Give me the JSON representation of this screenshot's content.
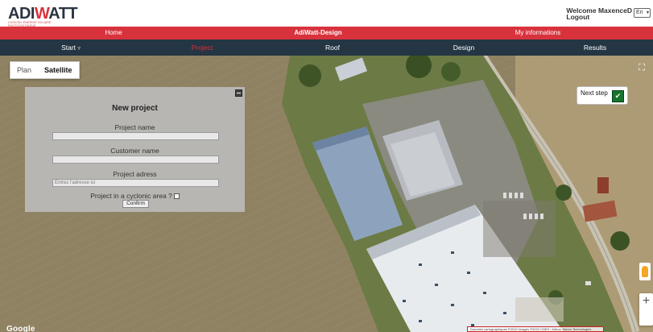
{
  "header": {
    "logo_text_a": "ADI",
    "logo_text_w": "W",
    "logo_text_b": "ATT",
    "logo_tagline": "LOGICIEL ÉNERGIE SOLAIRE PHOTOVOLTAÏQUE",
    "welcome_text": "Welcome  MaxenceD",
    "logout_label": "Logout",
    "language_value": "En"
  },
  "nav_top": {
    "items": [
      "Home",
      "AdiWatt-Design",
      "My informations"
    ]
  },
  "nav_main": {
    "start_label": "Start",
    "start_icon": "triangle-down",
    "items": [
      "Project",
      "Roof",
      "Design",
      "Results"
    ],
    "active": "Project",
    "active_color": "#d8323c"
  },
  "map": {
    "map_types": [
      "Plan",
      "Satellite"
    ],
    "selected_map_type": "Satellite",
    "next_step_label": "Next step",
    "next_step_icon": "checkmark-icon",
    "fullscreen_icon": "fullscreen-icon",
    "zoom_in_label": "+",
    "google_label": "Google",
    "attribution": "Données cartographiques ©2022 Images ©2022 CNES / Airbus, Maxar Technologies"
  },
  "panel": {
    "title": "New project",
    "project_name_label": "Project name",
    "project_name_value": "",
    "customer_name_label": "Customer name",
    "customer_name_value": "",
    "address_label": "Project adress",
    "address_placeholder": "Entrez l'adresse ici",
    "cyclonic_label": "Project in a cyclonic area ?",
    "cyclonic_checked": false,
    "confirm_label": "Confirm"
  },
  "colors": {
    "brand_red": "#d8323c",
    "nav_dark": "#243543",
    "next_step_green": "#16752c"
  }
}
